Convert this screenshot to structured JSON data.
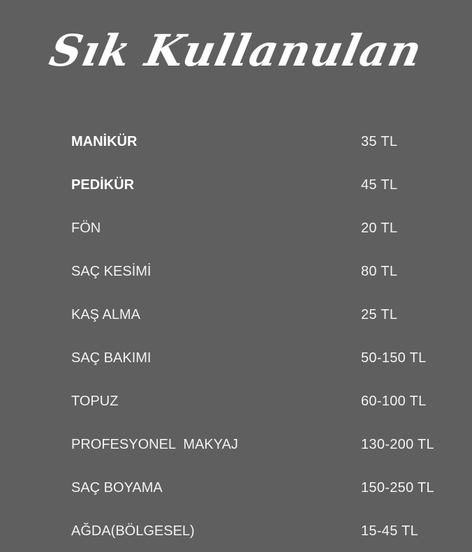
{
  "page": {
    "title": "Sık Kullanulan",
    "background_color": "#5f5f5f",
    "text_color": "#ffffff"
  },
  "price_list": [
    {
      "service": "MANİKÜR",
      "price": "35 TL",
      "bold": true
    },
    {
      "service": "PEDİKÜR",
      "price": "45 TL",
      "bold": true
    },
    {
      "service": "FÖN",
      "price": "20 TL",
      "bold": false
    },
    {
      "service": "SAÇ KESİMİ",
      "price": "80 TL",
      "bold": false
    },
    {
      "service": "KAŞ ALMA",
      "price": "25 TL",
      "bold": false
    },
    {
      "service": "SAÇ BAKIMI",
      "price": "50-150 TL",
      "bold": false
    },
    {
      "service": "TOPUZ",
      "price": "60-100 TL",
      "bold": false
    },
    {
      "service": "PROFESYONEL  MAKYAJ",
      "price": "130-200 TL",
      "bold": false
    },
    {
      "service": "SAÇ BOYAMA",
      "price": "150-250 TL",
      "bold": false
    },
    {
      "service": "AĞDA(BÖLGESEL)",
      "price": "15-45 TL",
      "bold": false
    }
  ]
}
